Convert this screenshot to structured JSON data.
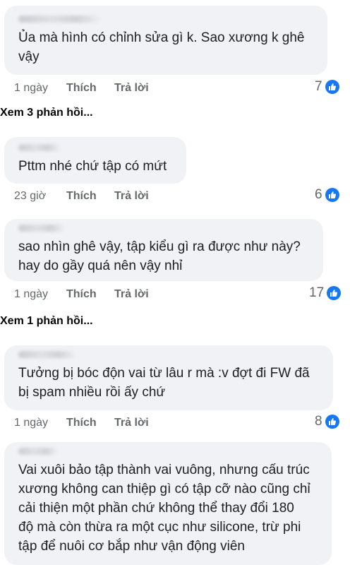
{
  "comments": [
    {
      "text": "Ủa mà hình có chỉnh sửa gì k. Sao xương k ghê\nvậy",
      "time": "1 ngày",
      "like_label": "Thích",
      "reply_label": "Trả lời",
      "reactions": "7"
    },
    {
      "text": "Pttm nhé chứ tập có mứt",
      "time": "23 giờ",
      "like_label": "Thích",
      "reply_label": "Trả lời",
      "reactions": "6"
    },
    {
      "text": "sao nhìn ghê vậy, tập kiểu gì ra được như này?\nhay do gầy quá nên vậy nhỉ",
      "time": "1 ngày",
      "like_label": "Thích",
      "reply_label": "Trả lời",
      "reactions": "17"
    },
    {
      "text": "Tưởng bị bóc độn vai từ lâu r mà :v đợt đi FW đã\nbị spam nhiều rồi ấy chứ",
      "time": "1 ngày",
      "like_label": "Thích",
      "reply_label": "Trả lời",
      "reactions": "8"
    },
    {
      "text": "Vai xuôi bảo tập thành vai vuông, nhưng cấu trúc\nxương không can thiệp gì có tập cỡ nào cũng chỉ\ncải thiện một phần chứ không thể thay đổi 180\nđộ mà còn thừa ra một cục như silicone, trừ phi\ntập để nuôi cơ bắp như vận động viên"
    }
  ],
  "view_replies": [
    "Xem 3 phản hồi...",
    "Xem 1 phản hồi..."
  ],
  "colors": {
    "bubble": "#f0f2f5",
    "like_blue": "#1877f2",
    "meta_gray": "#65676b"
  }
}
